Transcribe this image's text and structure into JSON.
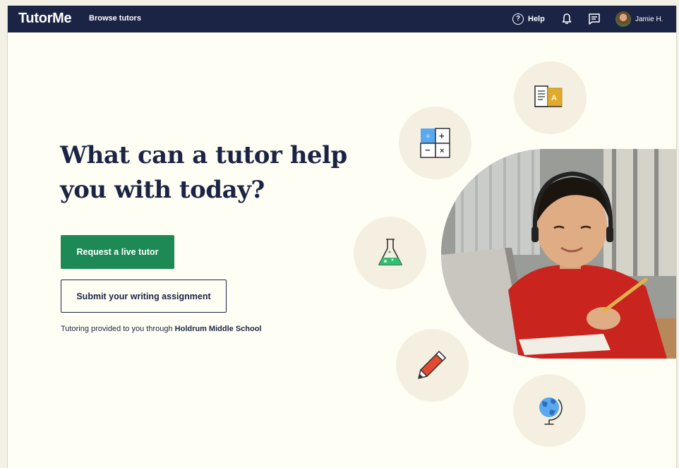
{
  "nav": {
    "logo": "TutorMe",
    "browse": "Browse tutors",
    "help": "Help",
    "help_glyph": "?",
    "user_name": "Jamie H."
  },
  "hero": {
    "headline": "What can a tutor help you with today?",
    "primary_button": "Request a live tutor",
    "secondary_button": "Submit your writing assignment",
    "provided_prefix": "Tutoring provided to you through",
    "school": "Holdrum Middle School"
  },
  "icons": [
    "books-icon",
    "calculator-icon",
    "flask-icon",
    "pencil-icon",
    "globe-icon"
  ],
  "colors": {
    "nav_bg": "#1b2444",
    "primary": "#1d8a55",
    "page_bg": "#fffef5",
    "circle_bg": "#f4efe0"
  }
}
